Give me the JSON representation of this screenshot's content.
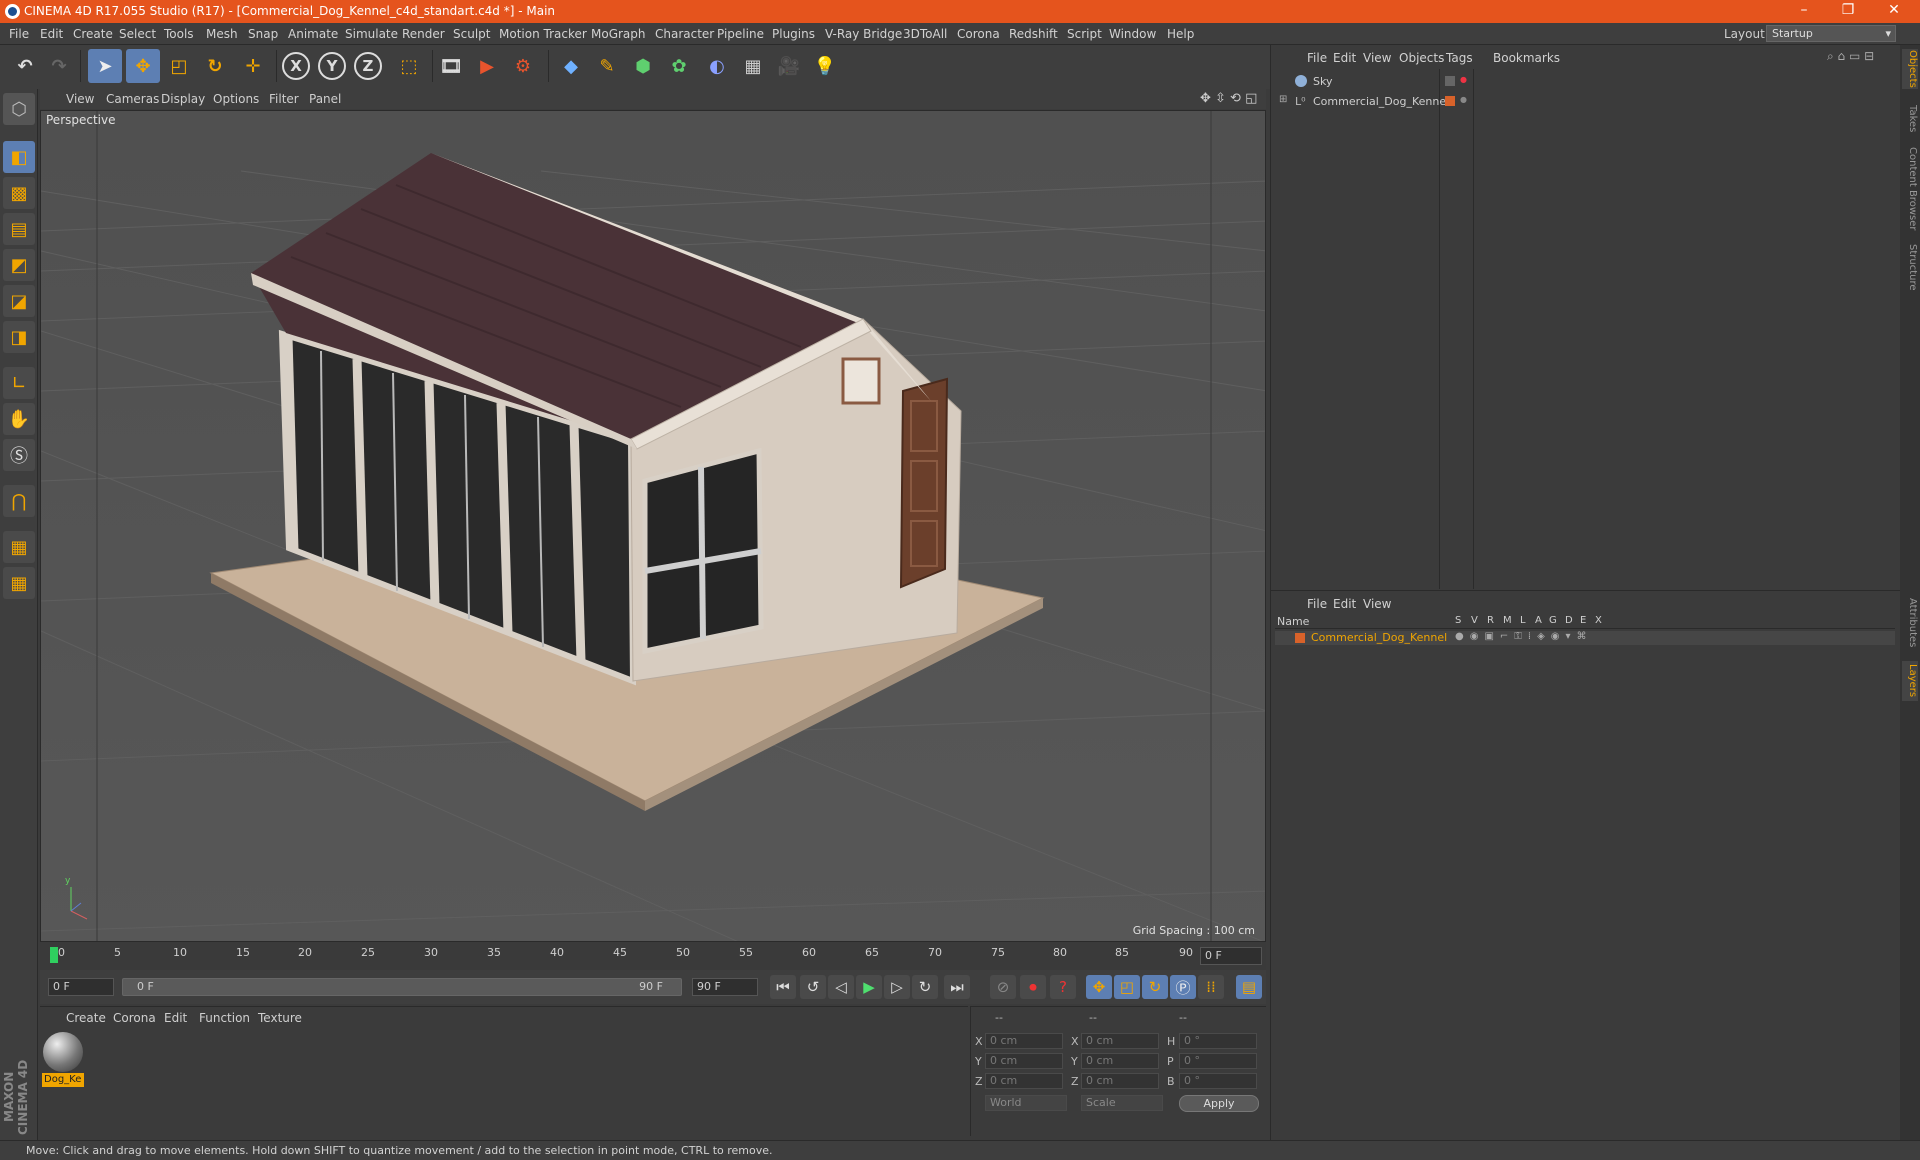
{
  "window": {
    "title": "CINEMA 4D R17.055 Studio (R17) - [Commercial_Dog_Kennel_c4d_standart.c4d *] - Main",
    "minimize": "–",
    "restore": "❐",
    "close": "✕"
  },
  "menubar": {
    "items": [
      "File",
      "Edit",
      "Create",
      "Select",
      "Tools",
      "Mesh",
      "Snap",
      "Animate",
      "Simulate",
      "Render",
      "Sculpt",
      "Motion Tracker",
      "MoGraph",
      "Character",
      "Pipeline",
      "Plugins",
      "V-Ray Bridge",
      "3DToAll",
      "Corona",
      "Redshift",
      "Script",
      "Window",
      "Help"
    ],
    "layout_label": "Layout:",
    "layout_value": "Startup"
  },
  "toolbar": {
    "icons": [
      "undo-icon",
      "redo-icon",
      "select-icon",
      "move-icon",
      "scale-icon",
      "rotate-icon",
      "transform-icon",
      "x-axis-icon",
      "y-axis-icon",
      "z-axis-icon",
      "coord-system-icon",
      "render-view-icon",
      "render-icon",
      "render-settings-icon",
      "cube-icon",
      "pen-icon",
      "subdivision-icon",
      "cloner-icon",
      "deformer-icon",
      "floor-icon",
      "camera-icon",
      "light-icon"
    ],
    "x_label": "X",
    "y_label": "Y",
    "z_label": "Z"
  },
  "viewport": {
    "menu": [
      "View",
      "Cameras",
      "Display",
      "Options",
      "Filter",
      "Panel"
    ],
    "label": "Perspective",
    "grid_spacing": "Grid Spacing : 100 cm"
  },
  "timeline": {
    "ticks": [
      "0",
      "5",
      "10",
      "15",
      "20",
      "25",
      "30",
      "35",
      "40",
      "45",
      "50",
      "55",
      "60",
      "65",
      "70",
      "75",
      "80",
      "85",
      "90"
    ],
    "current_frame": "0 F"
  },
  "playback": {
    "start_field": "0 F",
    "range_start": "0 F",
    "range_end": "90 F",
    "end_field": "90 F"
  },
  "materials": {
    "menu": [
      "Create",
      "Corona",
      "Edit",
      "Function",
      "Texture"
    ],
    "items": [
      {
        "name": "Dog_Ke"
      }
    ]
  },
  "coordinates": {
    "headers": [
      "--",
      "--",
      "--"
    ],
    "rows": [
      {
        "a": "X",
        "av": "0 cm",
        "b": "X",
        "bv": "0 cm",
        "c": "H",
        "cv": "0 °"
      },
      {
        "a": "Y",
        "av": "0 cm",
        "b": "Y",
        "bv": "0 cm",
        "c": "P",
        "cv": "0 °"
      },
      {
        "a": "Z",
        "av": "0 cm",
        "b": "Z",
        "bv": "0 cm",
        "c": "B",
        "cv": "0 °"
      }
    ],
    "mode": "World",
    "transform": "Scale",
    "apply": "Apply"
  },
  "object_manager": {
    "menu": [
      "File",
      "Edit",
      "View",
      "Objects",
      "Tags",
      "Bookmarks"
    ],
    "objects": [
      {
        "name": "Sky"
      },
      {
        "name": "Commercial_Dog_Kennel"
      }
    ]
  },
  "layer_manager": {
    "menu": [
      "File",
      "Edit",
      "View"
    ],
    "col_name": "Name",
    "columns": [
      "S",
      "V",
      "R",
      "M",
      "L",
      "A",
      "G",
      "D",
      "E",
      "X"
    ],
    "layers": [
      {
        "name": "Commercial_Dog_Kennel"
      }
    ]
  },
  "right_tabs": [
    "Objects",
    "Takes",
    "Content Browser",
    "Structure",
    "Attributes",
    "Layers"
  ],
  "status": "Move: Click and drag to move elements. Hold down SHIFT to quantize movement / add to the selection in point mode, CTRL to remove.",
  "branding": "MAXON CINEMA 4D",
  "colors": {
    "accent": "#f0a500",
    "titlebar": "#e5541d",
    "selection": "#5d7fb3"
  }
}
